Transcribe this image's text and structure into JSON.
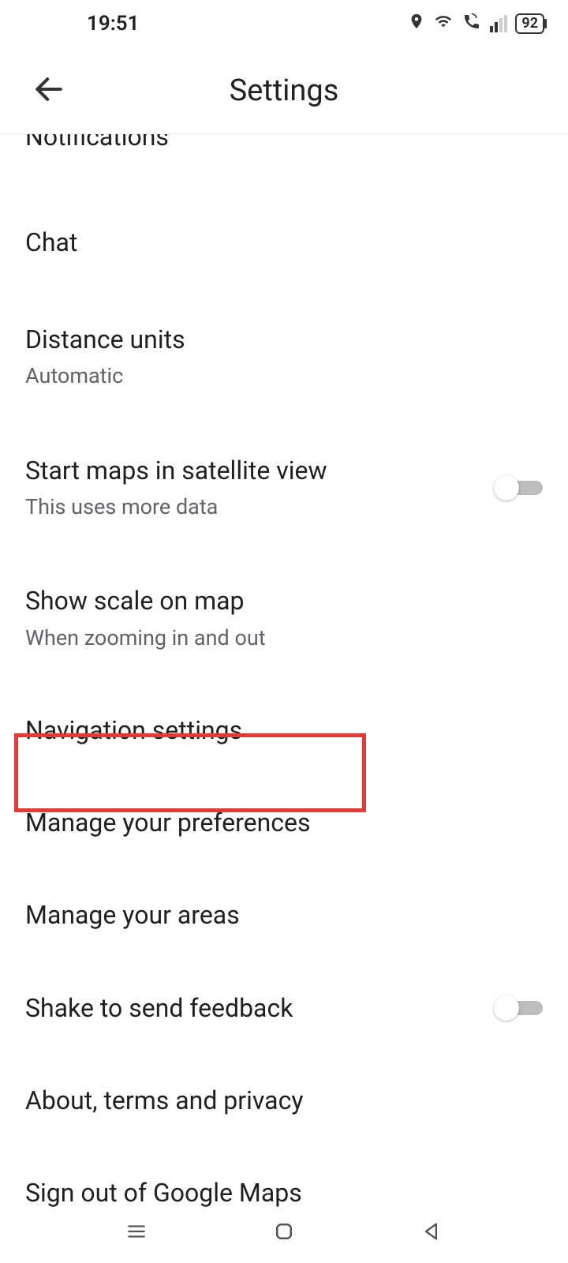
{
  "status": {
    "time": "19:51",
    "battery": "92"
  },
  "header": {
    "title": "Settings"
  },
  "items": {
    "notifications": {
      "title": "Notifications"
    },
    "chat": {
      "title": "Chat"
    },
    "distance": {
      "title": "Distance units",
      "sub": "Automatic"
    },
    "satellite": {
      "title": "Start maps in satellite view",
      "sub": "This uses more data"
    },
    "scale": {
      "title": "Show scale on map",
      "sub": "When zooming in and out"
    },
    "navigation": {
      "title": "Navigation settings"
    },
    "preferences": {
      "title": "Manage your preferences"
    },
    "areas": {
      "title": "Manage your areas"
    },
    "shake": {
      "title": "Shake to send feedback"
    },
    "about": {
      "title": "About, terms and privacy"
    },
    "signout": {
      "title": "Sign out of Google Maps"
    }
  }
}
